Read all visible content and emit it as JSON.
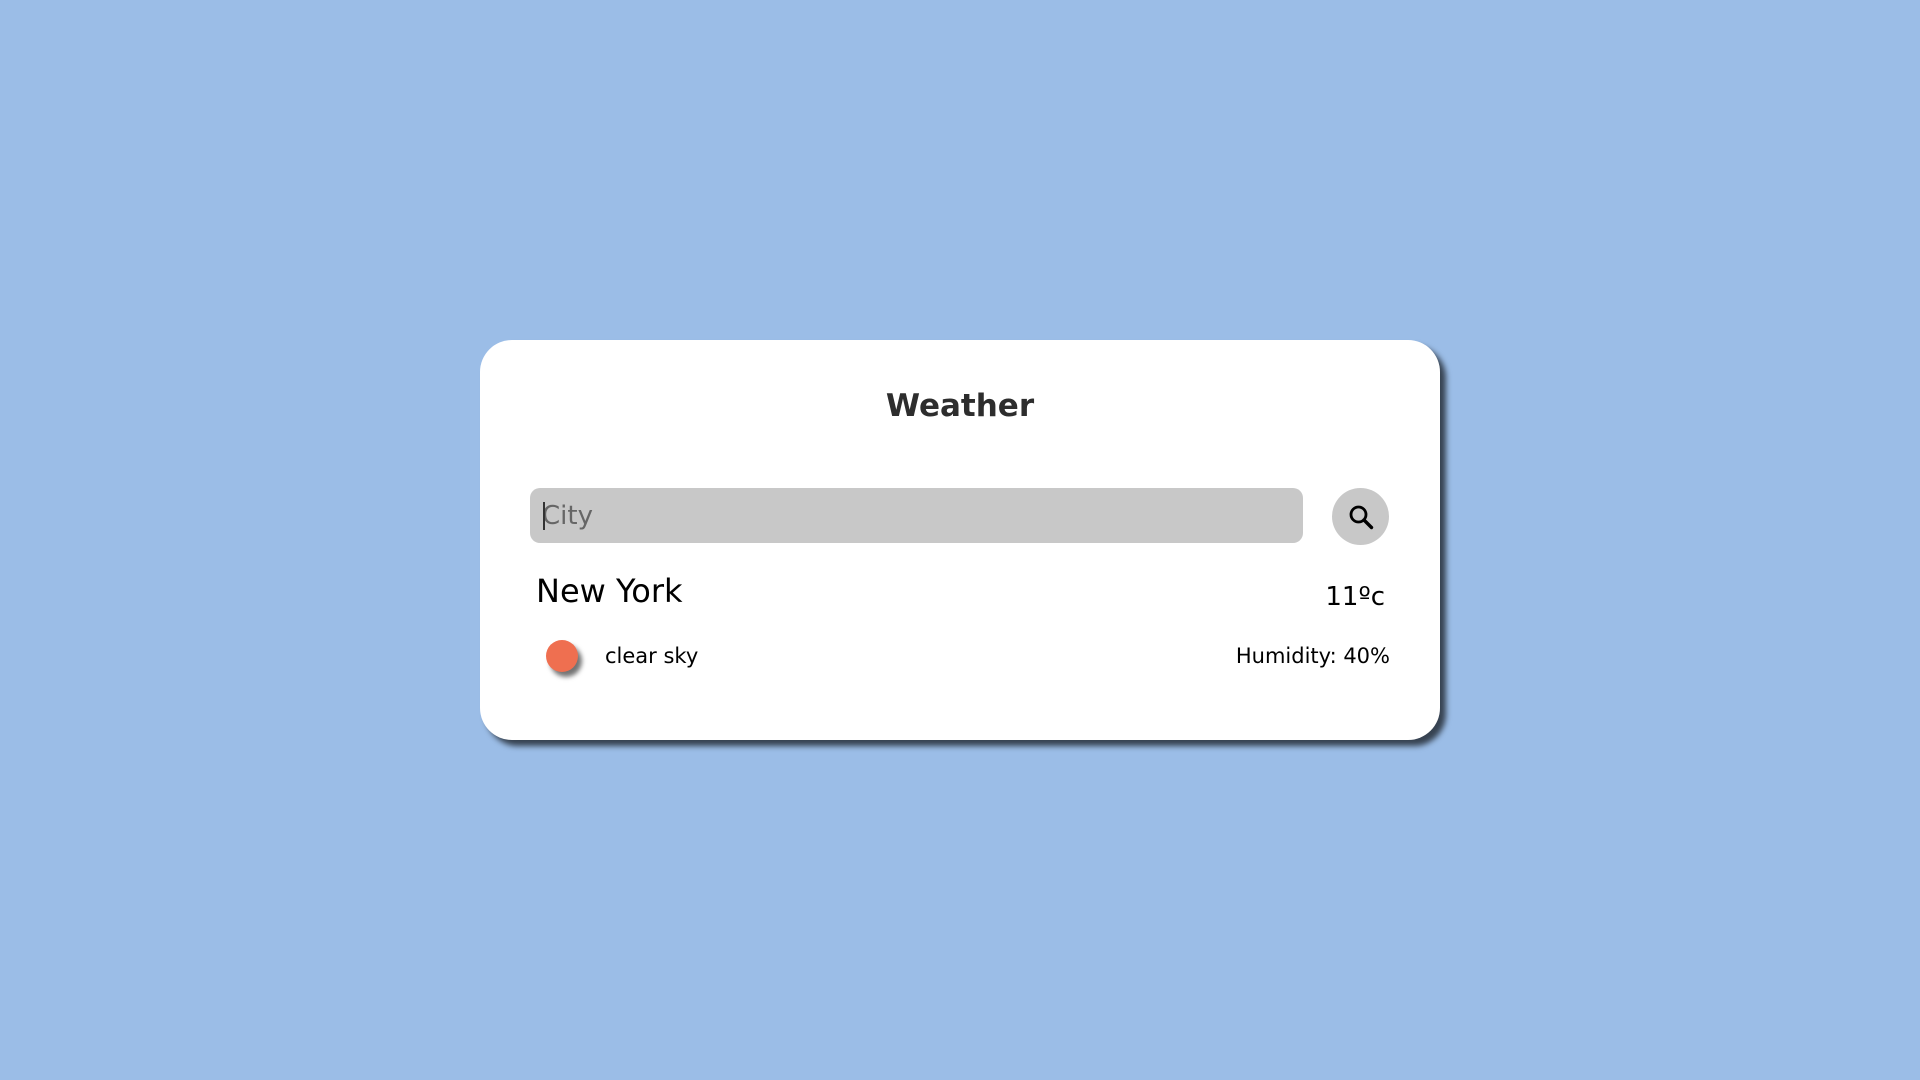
{
  "colors": {
    "background": "#9bbde7",
    "card": "#ffffff",
    "input_bg": "#c8c8c8",
    "condition_icon": "#ef6f50"
  },
  "card": {
    "title": "Weather",
    "search": {
      "placeholder": "City",
      "value": "",
      "button_icon": "search-icon"
    },
    "result": {
      "city": "New York",
      "temperature": "11ºc",
      "condition_icon": "weather-condition-icon",
      "condition": "clear sky",
      "humidity": "Humidity: 40%"
    }
  }
}
